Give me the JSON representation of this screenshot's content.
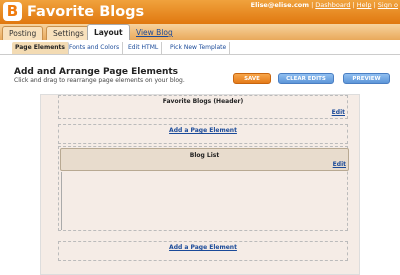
{
  "app": {
    "blog_title": "Favorite Blogs",
    "logo_letter": "B",
    "user_email": "Elise@elise.com",
    "links": [
      "Dashboard",
      "Help",
      "Sign o"
    ]
  },
  "tabs": [
    {
      "label": "Posting"
    },
    {
      "label": "Settings"
    },
    {
      "label": "Layout"
    },
    {
      "label": "View Blog"
    }
  ],
  "subtabs": [
    {
      "label": "Page Elements"
    },
    {
      "label": "Fonts and Colors"
    },
    {
      "label": "Edit HTML"
    },
    {
      "label": "Pick New Template"
    }
  ],
  "page": {
    "title": "Add and Arrange Page Elements",
    "subtitle": "Click and drag to rearrange page elements on your blog."
  },
  "buttons": {
    "save": "SAVE",
    "clear": "CLEAR EDITS",
    "preview": "PREVIEW"
  },
  "elements": {
    "header_title": "Favorite Blogs (Header)",
    "blog_list_title": "Blog List",
    "edit": "Edit",
    "add": "Add a Page Element"
  },
  "colors": {
    "topbar": "#e8861f",
    "link": "#1a4a99",
    "save": "#ee8f2e",
    "blue_button": "#6fa3e0",
    "canvas": "#f5ece6"
  }
}
